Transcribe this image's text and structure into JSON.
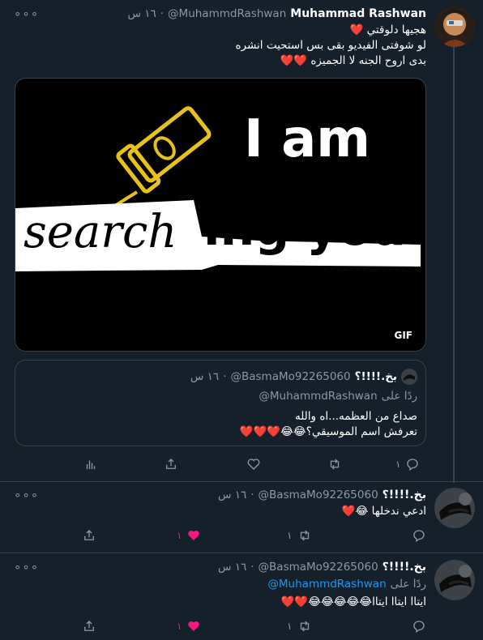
{
  "tweets": [
    {
      "name": "Muhammad Rashwan",
      "handle": "@MuhammdRashwan",
      "time": "١٦ س",
      "sep": "·",
      "lines": [
        "هجيها دلوقتي ❤️",
        "لو شوفتى الفيديو بقى بس استحيت انشره",
        "بدى اروح الجنه لا الجميزه ❤️❤️"
      ],
      "media": {
        "line1": "I am",
        "word_search": "search",
        "word_rest": "ing you",
        "badge": "GIF"
      },
      "quote": {
        "name": "بخ.!!!!؟",
        "handle": "@BasmaMo92265060",
        "time": "١٦ س",
        "sep": "·",
        "reply_prefix": "ردًا على",
        "reply_to": "@MuhammdRashwan",
        "lines": [
          "صداع من العظمه...اه والله",
          "تعرفش اسم الموسيقي؟😂😂❤️❤️❤️"
        ]
      },
      "actions": {
        "reply": "١",
        "retweet": "",
        "like": "",
        "share": "",
        "analytics": ""
      }
    },
    {
      "name": "بخ.!!!!؟",
      "handle": "@BasmaMo92265060",
      "time": "١٦ س",
      "sep": "·",
      "lines": [
        "ادعي ندخلها 😂❤️"
      ],
      "actions": {
        "reply": "",
        "retweet": "١",
        "like": "١",
        "share": ""
      }
    },
    {
      "name": "بخ.!!!!؟",
      "handle": "@BasmaMo92265060",
      "time": "١٦ س",
      "sep": "·",
      "reply_prefix": "ردًا على",
      "reply_to": "@MuhammdRashwan",
      "lines": [
        "ايتاا ايتاا ايتاا😂😂😂😂😂❤️❤️"
      ],
      "actions": {
        "reply": "",
        "retweet": "١",
        "like": "١",
        "share": ""
      }
    }
  ],
  "icons": {
    "more": "more-horizontal-icon",
    "reply": "reply-icon",
    "retweet": "retweet-icon",
    "like": "heart-icon",
    "share": "share-icon",
    "analytics": "analytics-icon"
  },
  "colors": {
    "background": "#15202b",
    "border": "#38444d",
    "muted": "#8b98a5",
    "link": "#1d9bf0",
    "like": "#f91880"
  }
}
